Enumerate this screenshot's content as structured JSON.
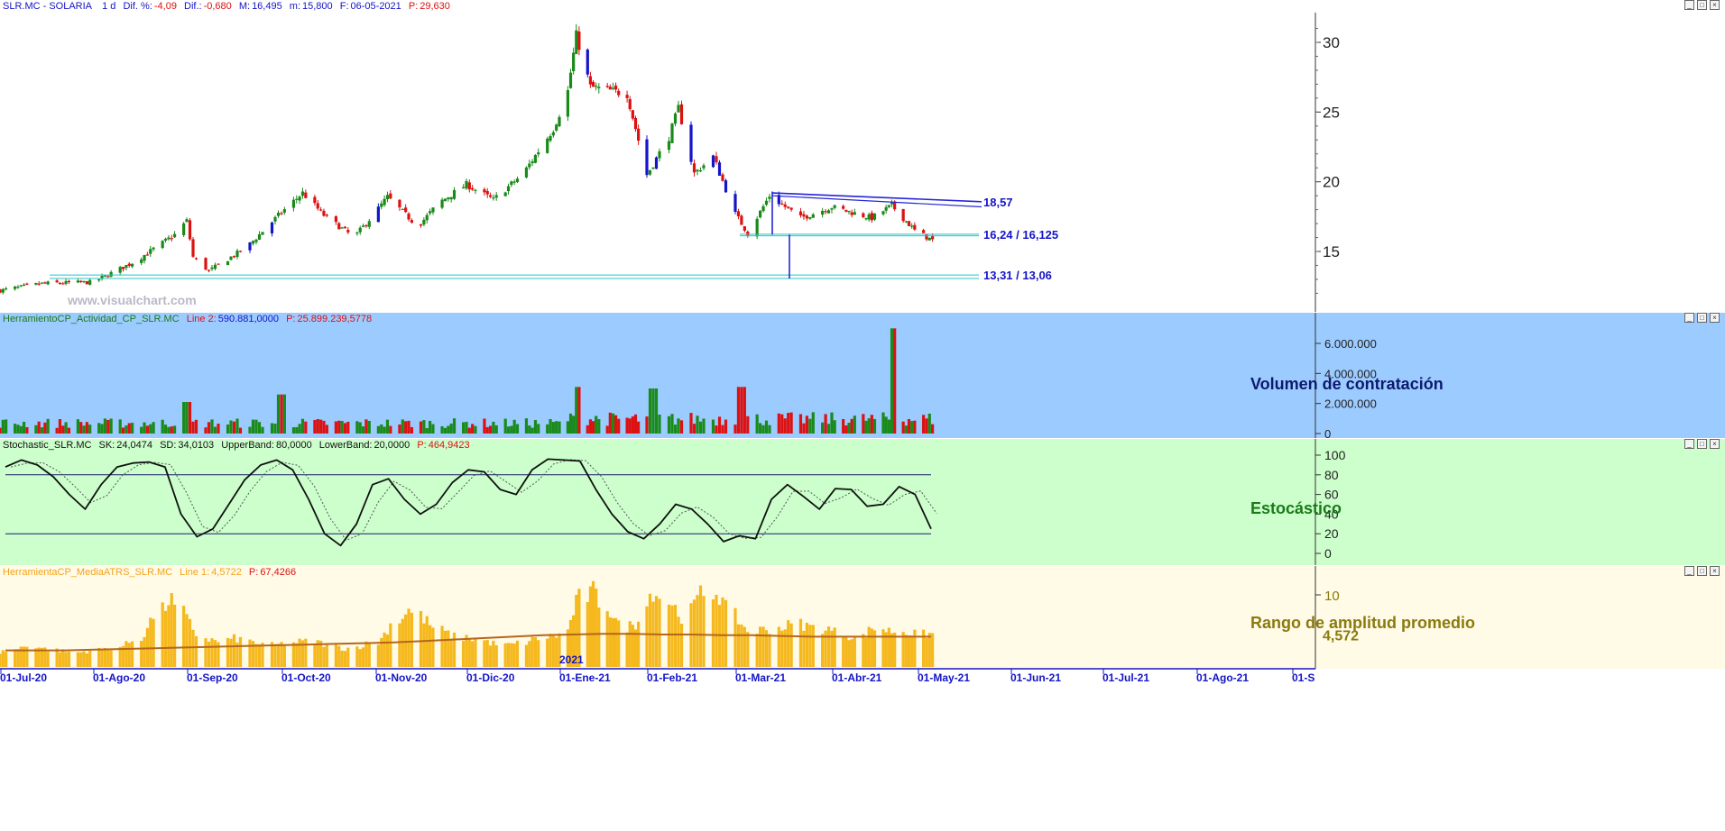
{
  "header": {
    "symbol": "SLR.MC - SOLARIA",
    "interval": "1 d",
    "dif_pct_label": "Dif. %:",
    "dif_pct": "-4,09",
    "dif_label": "Dif.:",
    "dif": "-0,680",
    "max_label": "M:",
    "max": "16,495",
    "min_label": "m:",
    "min": "15,800",
    "date_label": "F:",
    "date": "06-05-2021",
    "p_label": "P:",
    "p": "29,630"
  },
  "watermark": "www.visualchart.com",
  "volume_header": {
    "name": "HerramientoCP_Actividad_CP_SLR.MC",
    "line_label": "Line 2:",
    "line_value": "590.881,0000",
    "p_label": "P:",
    "p_value": "25.899.239,5778"
  },
  "stoch_header": {
    "name": "Stochastic_SLR.MC",
    "sk_label": "SK:",
    "sk": "24,0474",
    "sd_label": "SD:",
    "sd": "34,0103",
    "ub_label": "UpperBand:",
    "ub": "80,0000",
    "lb_label": "LowerBand:",
    "lb": "20,0000",
    "p_label": "P:",
    "p": "464,9423"
  },
  "atr_header": {
    "name": "HerramientaCP_MediaATRS_SLR.MC",
    "line_label": "Line 1:",
    "line_value": "4,5722",
    "p_label": "P:",
    "p": "67,4266"
  },
  "panel_titles": {
    "volume": "Volumen de contratación",
    "stoch": "Estocástico",
    "atr": "Rango de amplitud promedio"
  },
  "year_label": "2021",
  "colors": {
    "up": "#1a8a1a",
    "down": "#dd1111",
    "blue_bar": "#1414c8",
    "volume_bg": "#9ccbff",
    "stoch_bg": "#ccffcc",
    "atr_bg": "#fffbe6",
    "level": "#26c4c4",
    "trend": "#2525d6",
    "atr_bar": "#f5b81d",
    "atr_line": "#b5651d"
  },
  "chart_data": [
    {
      "type": "candlestick",
      "title": "SLR.MC - SOLARIA",
      "x_ticks": [
        "01-Jul-20",
        "01-Ago-20",
        "01-Sep-20",
        "01-Oct-20",
        "01-Nov-20",
        "01-Dic-20",
        "01-Ene-21",
        "01-Feb-21",
        "01-Mar-21",
        "01-Abr-21",
        "01-May-21",
        "01-Jun-21",
        "01-Jul-21",
        "01-Ago-21",
        "01-S"
      ],
      "ylim": [
        11.5,
        32
      ],
      "y_ticks": [
        15,
        20,
        25,
        30
      ],
      "close_path": [
        {
          "x": "01-Jul-20",
          "y": 12.2
        },
        {
          "x": "15-Jul-20",
          "y": 12.7
        },
        {
          "x": "01-Ago-20",
          "y": 12.8
        },
        {
          "x": "15-Ago-20",
          "y": 14.3
        },
        {
          "x": "28-Ago-20",
          "y": 16.2
        },
        {
          "x": "01-Sep-20",
          "y": 17.2
        },
        {
          "x": "03-Sep-20",
          "y": 14.6
        },
        {
          "x": "08-Sep-20",
          "y": 13.6
        },
        {
          "x": "20-Sep-20",
          "y": 15.3
        },
        {
          "x": "01-Oct-20",
          "y": 17.8
        },
        {
          "x": "08-Oct-20",
          "y": 19.2
        },
        {
          "x": "15-Oct-20",
          "y": 17.6
        },
        {
          "x": "25-Oct-20",
          "y": 16.0
        },
        {
          "x": "01-Nov-20",
          "y": 17.8
        },
        {
          "x": "05-Nov-20",
          "y": 18.9
        },
        {
          "x": "15-Nov-20",
          "y": 16.8
        },
        {
          "x": "22-Nov-20",
          "y": 18.5
        },
        {
          "x": "01-Dic-20",
          "y": 19.8
        },
        {
          "x": "10-Dic-20",
          "y": 18.7
        },
        {
          "x": "20-Dic-20",
          "y": 20.6
        },
        {
          "x": "30-Dic-20",
          "y": 23.8
        },
        {
          "x": "04-Ene-21",
          "y": 26.5
        },
        {
          "x": "07-Ene-21",
          "y": 30.5
        },
        {
          "x": "12-Ene-21",
          "y": 26.8
        },
        {
          "x": "25-Ene-21",
          "y": 26.3
        },
        {
          "x": "01-Feb-21",
          "y": 20.5
        },
        {
          "x": "08-Feb-21",
          "y": 23.2
        },
        {
          "x": "11-Feb-21",
          "y": 25.3
        },
        {
          "x": "16-Feb-21",
          "y": 20.6
        },
        {
          "x": "22-Feb-21",
          "y": 21.8
        },
        {
          "x": "01-Mar-21",
          "y": 17.7
        },
        {
          "x": "05-Mar-21",
          "y": 16.3
        },
        {
          "x": "12-Mar-21",
          "y": 19.0
        },
        {
          "x": "22-Mar-21",
          "y": 17.4
        },
        {
          "x": "01-Abr-21",
          "y": 18.2
        },
        {
          "x": "15-Abr-21",
          "y": 17.4
        },
        {
          "x": "22-Abr-21",
          "y": 18.3
        },
        {
          "x": "30-Abr-21",
          "y": 16.5
        },
        {
          "x": "06-May-21",
          "y": 15.8
        }
      ],
      "levels": [
        {
          "label": "18,57",
          "value": 18.57
        },
        {
          "label": "16,24 / 16,125",
          "value": 16.24,
          "value2": 16.125
        },
        {
          "label": "13,31 / 13,06",
          "value": 13.31,
          "value2": 13.06
        }
      ]
    },
    {
      "type": "bar",
      "title": "Volumen de contratación",
      "ylim": [
        0,
        7200000
      ],
      "y_ticks": [
        "0",
        "2.000.000",
        "4.000.000",
        "6.000.000"
      ],
      "spikes": [
        {
          "x": "01-Sep-20",
          "y": 2100000
        },
        {
          "x": "01-Oct-20",
          "y": 2600000
        },
        {
          "x": "08-Ene-21",
          "y": 3100000
        },
        {
          "x": "03-Feb-21",
          "y": 3000000
        },
        {
          "x": "03-Mar-21",
          "y": 3100000
        },
        {
          "x": "23-Abr-21",
          "y": 7000000
        }
      ],
      "baseline": 600000
    },
    {
      "type": "line",
      "title": "Estocástico",
      "ylim": [
        0,
        100
      ],
      "y_ticks": [
        "0",
        "20",
        "40",
        "60",
        "80",
        "100"
      ],
      "bands": [
        80,
        20
      ],
      "series": [
        {
          "values": [
            88,
            95,
            90,
            78,
            60,
            45,
            70,
            88,
            92,
            93,
            88,
            40,
            17,
            25,
            50,
            75,
            90,
            95,
            85,
            55,
            20,
            8,
            30,
            70,
            76,
            55,
            40,
            50,
            72,
            85,
            83,
            65,
            60,
            85,
            96,
            95,
            94,
            65,
            40,
            22,
            15,
            30,
            50,
            45,
            30,
            12,
            18,
            15,
            55,
            70,
            58,
            45,
            66,
            65,
            48,
            50,
            68,
            60,
            25
          ]
        }
      ]
    },
    {
      "type": "bar",
      "title": "Rango de amplitud promedio",
      "y_ticks": [
        "10"
      ],
      "last_value_label": "4,572",
      "series": [
        {
          "name": "ATR",
          "values": [
            2,
            2.5,
            3,
            2.5,
            2.2,
            2,
            2.3,
            2.5,
            3,
            4,
            7,
            9.6,
            6.5,
            4,
            3.5,
            4,
            3.5,
            3,
            3.2,
            3.5,
            3.5,
            3,
            2.5,
            3,
            3.5,
            6,
            8,
            6.5,
            5,
            4.2,
            4,
            3.5,
            3,
            3.2,
            3.8,
            4.2,
            4.5,
            9.3,
            10.5,
            8,
            5.5,
            6,
            10.8,
            9,
            7,
            10,
            10.5,
            7,
            5,
            5.2,
            5.5,
            6,
            5.5,
            5.2,
            4.5,
            4,
            5.5,
            5,
            5,
            4.5,
            4.6
          ]
        },
        {
          "name": "Media",
          "values": [
            2.3,
            2.3,
            2.3,
            2.4,
            2.5,
            2.6,
            2.7,
            2.8,
            2.9,
            3,
            3.1,
            3.2,
            3.3,
            3.4,
            3.6,
            3.8,
            4,
            4.2,
            4.4,
            4.5,
            4.6,
            4.6,
            4.5,
            4.5,
            4.4,
            4.4,
            4.3,
            4.2,
            4.2,
            4.2,
            4.2,
            4.2
          ]
        }
      ]
    }
  ]
}
